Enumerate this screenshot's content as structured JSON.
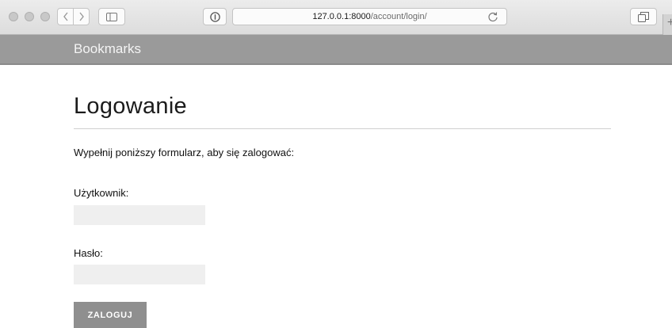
{
  "browser": {
    "url_host": "127.0.0.1:8000",
    "url_path": "/account/login/",
    "new_tab_label": "+"
  },
  "site": {
    "brand": "Bookmarks"
  },
  "login": {
    "title": "Logowanie",
    "intro": "Wypełnij poniższy formularz, aby się zalogować:",
    "username_label": "Użytkownik:",
    "username_value": "",
    "password_label": "Hasło:",
    "password_value": "",
    "submit_label": "ZALOGUJ"
  },
  "colors": {
    "header_bg": "#9a9a9a",
    "button_bg": "#8f8f8f",
    "input_bg": "#efefef"
  },
  "icons": [
    "back-icon",
    "forward-icon",
    "sidebar-icon",
    "privacy-info-icon",
    "reload-icon",
    "tabs-overview-icon",
    "plus-icon"
  ]
}
